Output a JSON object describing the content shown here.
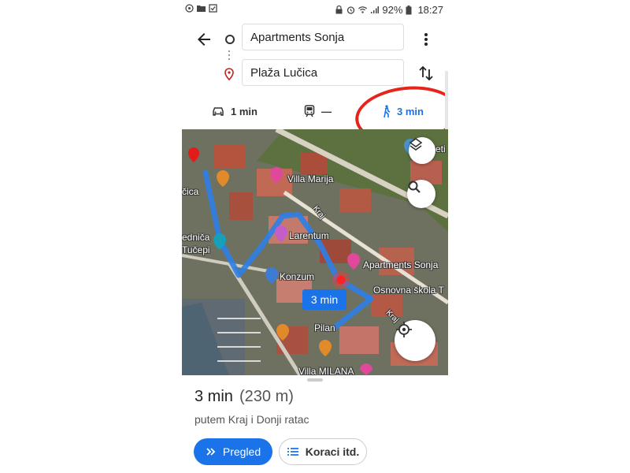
{
  "status_bar": {
    "battery": "92%",
    "time": "18:27"
  },
  "route": {
    "origin": "Apartments Sonja",
    "destination": "Plaža Lučica"
  },
  "modes": {
    "car_time": "1 min",
    "transit_time": "—",
    "walk_time": "3 min"
  },
  "map": {
    "labels": {
      "villa_marija": "Villa Marija",
      "larentum": "Larentum",
      "konzum": "Konzum",
      "apartments_sonja": "Apartments Sonja",
      "osnovna_skola": "Osnovna škola T",
      "pilan": "Pilan",
      "villa_milana": "Villa MILANA",
      "kraj_1": "Kraj",
      "kraj_2": "Kraj",
      "lucica": "čica",
      "ednica": "edničа",
      "tucepi": "Tučepi",
      "eti": "eti"
    },
    "route_badge": "3 min"
  },
  "summary": {
    "time": "3 min",
    "distance": "(230 m)",
    "via": "putem Kraj i Donji ratac"
  },
  "actions": {
    "preview": "Pregled",
    "steps": "Koraci itd."
  },
  "colors": {
    "accent": "#1a73e8",
    "highlight": "#e5241b"
  }
}
